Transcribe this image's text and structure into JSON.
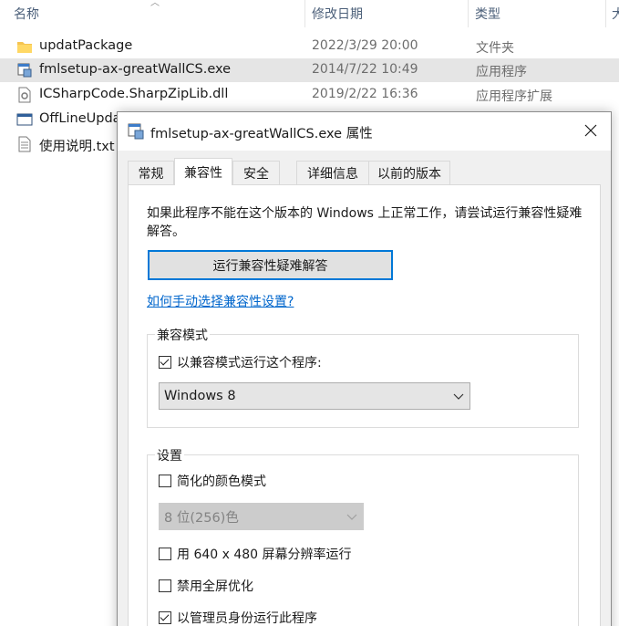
{
  "explorer": {
    "columns": {
      "name": "名称",
      "modified": "修改日期",
      "type": "类型",
      "size": "大"
    },
    "files": [
      {
        "name": "updatPackage",
        "date": "2022/3/29 20:00",
        "type": "文件夹",
        "icon": "folder-icon"
      },
      {
        "name": "fmlsetup-ax-greatWallCS.exe",
        "date": "2014/7/22 10:49",
        "type": "应用程序",
        "icon": "exe-icon"
      },
      {
        "name": "ICSharpCode.SharpZipLib.dll",
        "date": "2019/2/22 16:36",
        "type": "应用程序扩展",
        "icon": "dll-icon"
      },
      {
        "name": "OffLineUpda",
        "date": "",
        "type": "",
        "icon": "app-window-icon"
      },
      {
        "name": "使用说明.txt",
        "date": "",
        "type": "",
        "icon": "text-file-icon"
      }
    ]
  },
  "dialog": {
    "title": "fmlsetup-ax-greatWallCS.exe 属性",
    "tabs": [
      "常规",
      "兼容性",
      "安全",
      "详细信息",
      "以前的版本"
    ],
    "active_tab": "兼容性",
    "description": "如果此程序不能在这个版本的 Windows 上正常工作，请尝试运行兼容性疑难解答。",
    "troubleshoot_button": "运行兼容性疑难解答",
    "help_link": "如何手动选择兼容性设置?",
    "compat_mode": {
      "group_title": "兼容模式",
      "checkbox_label": "以兼容模式运行这个程序:",
      "checked": true,
      "selected_os": "Windows 8"
    },
    "settings": {
      "group_title": "设置",
      "reduced_color_label": "简化的颜色模式",
      "reduced_color_checked": false,
      "color_option": "8 位(256)色",
      "resolution_label": "用 640 x 480 屏幕分辨率运行",
      "resolution_checked": false,
      "fullscreen_label": "禁用全屏优化",
      "fullscreen_checked": false,
      "admin_label": "以管理员身份运行此程序",
      "admin_checked": true
    }
  }
}
